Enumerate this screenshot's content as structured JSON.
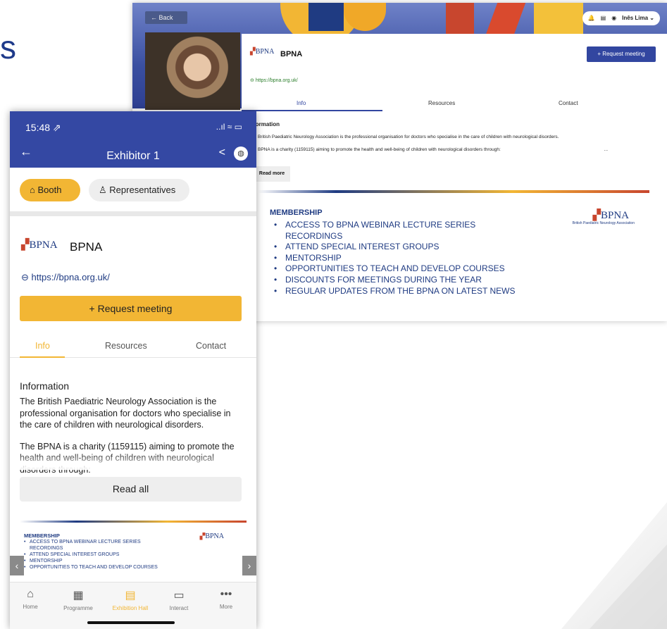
{
  "background": {
    "heading_fragment": "s"
  },
  "desktop": {
    "back_label": "← Back",
    "user_name": "Inês Lima ⌄",
    "exhibitor_name": "BPNA",
    "logo_text": "BPNA",
    "url": "https://bpna.org.uk/",
    "request_label": "+ Request meeting",
    "tabs": [
      "Info",
      "Resources",
      "Contact"
    ],
    "info_title": "Information",
    "info_p1": "The British Paediatric Neurology Association is the professional organisation for doctors who specialise in the care of children with neurological disorders.",
    "info_p2": "The BPNA is a charity (1159115) aiming to promote the health and well-being of children with neurological disorders through:",
    "info_ellipsis": "...",
    "read_more": "Read more",
    "membership_title": "MEMBERSHIP",
    "membership_items": [
      "ACCESS TO BPNA WEBINAR LECTURE SERIES RECORDINGS",
      "ATTEND SPECIAL INTEREST GROUPS",
      "MENTORSHIP",
      "OPPORTUNITIES TO TEACH AND DEVELOP COURSES",
      "DISCOUNTS FOR MEETINGS DURING THE YEAR",
      "REGULAR UPDATES FROM THE BPNA ON LATEST NEWS"
    ],
    "banner_logo": "BPNA",
    "banner_logo_sub": "British Paediatric Neurology Association"
  },
  "phone": {
    "time": "15:48 ⇗",
    "status": "..ıl ≈ ▭",
    "title": "Exhibitor 1",
    "booth_label": "Booth",
    "reps_label": "Representatives",
    "logo_text": "BPNA",
    "exhibitor_name": "BPNA",
    "url": "https://bpna.org.uk/",
    "request_label": "+ Request meeting",
    "tabs": [
      "Info",
      "Resources",
      "Contact"
    ],
    "info_title": "Information",
    "info_p1": "The British Paediatric Neurology Association is the professional organisation for doctors who specialise in the care of children with neurological disorders.",
    "info_p2": "The BPNA is a charity (1159115) aiming to promote the health and well-being of children with neurological disorders through:",
    "read_all": "Read all",
    "membership_title": "MEMBERSHIP",
    "membership_items": [
      "ACCESS TO BPNA WEBINAR LECTURE SERIES RECORDINGS",
      "ATTEND SPECIAL INTEREST GROUPS",
      "MENTORSHIP",
      "OPPORTUNITIES TO TEACH AND DEVELOP COURSES"
    ],
    "banner_logo": "BPNA",
    "nav": [
      {
        "label": "Home",
        "icon": "home-icon",
        "glyph": "⌂"
      },
      {
        "label": "Programme",
        "icon": "calendar-icon",
        "glyph": "▦"
      },
      {
        "label": "Exhibition Hall",
        "icon": "exhibition-icon",
        "glyph": "▤"
      },
      {
        "label": "Interact",
        "icon": "chat-icon",
        "glyph": "▭"
      },
      {
        "label": "More",
        "icon": "more-icon",
        "glyph": "•••"
      }
    ],
    "active_nav": "Exhibition Hall",
    "accent_color": "#f2b634",
    "brand_color": "#3448a3"
  }
}
